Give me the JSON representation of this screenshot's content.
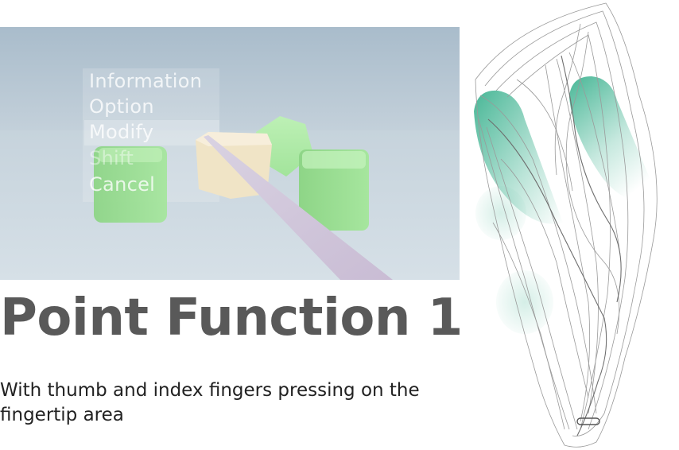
{
  "scene": {
    "menu_items": [
      "Information",
      "Option",
      "Modify",
      "Shift",
      "Cancel"
    ],
    "highlighted_item": "Modify"
  },
  "heading": "Point Function 1",
  "description": "With thumb and index fingers pressing on the fingertip area",
  "colors": {
    "accent_teal": "#3fb391",
    "cube_green": "#9fe49a",
    "cube_beige": "#efe3c4",
    "scene_background": "#b4c4d1",
    "heading_text": "#595959"
  }
}
